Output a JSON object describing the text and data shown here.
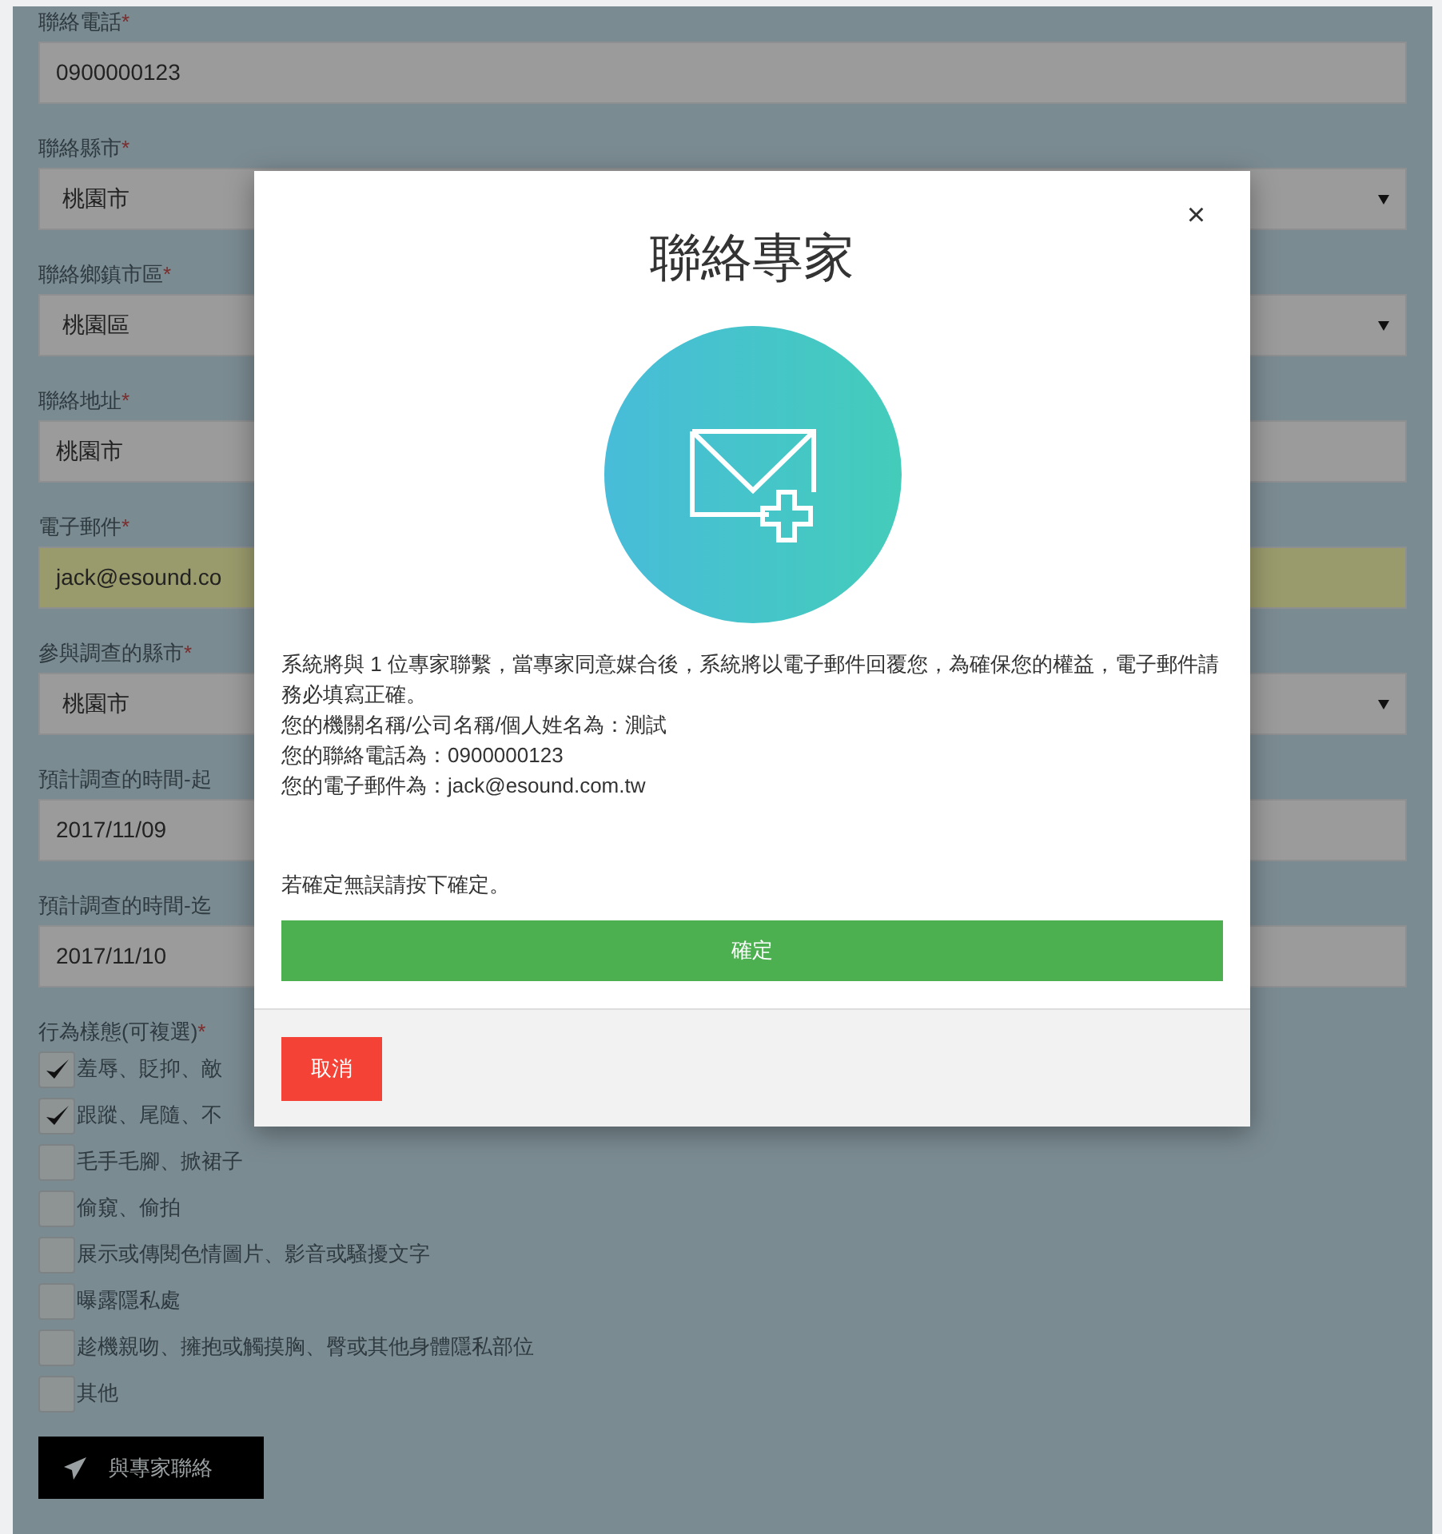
{
  "form": {
    "fields": [
      {
        "kind": "text",
        "label": "聯絡電話",
        "required_mark": "*",
        "value": "0900000123",
        "autofilled": false
      },
      {
        "kind": "select",
        "label": "聯絡縣市",
        "required_mark": "*",
        "value": "桃園市",
        "autofilled": false
      },
      {
        "kind": "select",
        "label": "聯絡鄉鎮市區",
        "required_mark": "*",
        "value": "桃園區",
        "autofilled": false
      },
      {
        "kind": "text",
        "label": "聯絡地址",
        "required_mark": "*",
        "value": "桃園市",
        "autofilled": false
      },
      {
        "kind": "text",
        "label": "電子郵件",
        "required_mark": "*",
        "value": "jack@esound.co",
        "autofilled": true
      },
      {
        "kind": "select",
        "label": "參與調查的縣市",
        "required_mark": "*",
        "value": "桃園市",
        "autofilled": false
      },
      {
        "kind": "text",
        "label": "預計調查的時間-起",
        "value": "2017/11/09",
        "autofilled": false
      },
      {
        "kind": "text",
        "label": "預計調查的時間-迄",
        "value": "2017/11/10",
        "autofilled": false
      }
    ],
    "behaviors": {
      "label": "行為樣態(可複選)",
      "required_mark": "*",
      "options": [
        {
          "label": "羞辱、貶抑、敵",
          "checked": true
        },
        {
          "label": "跟蹤、尾隨、不",
          "checked": true
        },
        {
          "label": "毛手毛腳、掀裙子",
          "checked": false
        },
        {
          "label": "偷窺、偷拍",
          "checked": false
        },
        {
          "label": "展示或傳閱色情圖片、影音或騷擾文字",
          "checked": false
        },
        {
          "label": "曝露隱私處",
          "checked": false
        },
        {
          "label": "趁機親吻、擁抱或觸摸胸、臀或其他身體隱私部位",
          "checked": false
        },
        {
          "label": "其他",
          "checked": false
        }
      ]
    },
    "submit_button": "與專家聯絡"
  },
  "modal": {
    "close": "×",
    "title": "聯絡專家",
    "message": [
      "系統將與 1 位專家聯繫，當專家同意媒合後，系統將以電子郵件回覆您，為確保您的權益，電子郵件請務必填寫正確。",
      "您的機關名稱/公司名稱/個人姓名為：測試",
      "您的聯絡電話為：0900000123",
      "您的電子郵件為：jack@esound.com.tw"
    ],
    "confirm_prompt": "若確定無誤請按下確定。",
    "confirm_button": "確定",
    "cancel_button": "取消"
  }
}
